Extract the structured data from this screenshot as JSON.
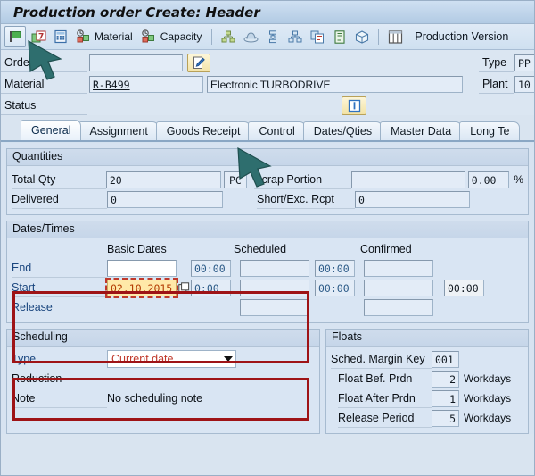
{
  "window": {
    "title": "Production order Create: Header"
  },
  "toolbar": {
    "icons": [
      {
        "name": "green-flag-icon",
        "glyph": "flag"
      },
      {
        "name": "order-info-icon",
        "glyph": "seven"
      },
      {
        "name": "calculator-icon",
        "glyph": "calc"
      }
    ],
    "material_label": "Material",
    "capacity_label": "Capacity",
    "production_version_label": "Production Version",
    "extra_icons": [
      {
        "name": "hierarchy-icon"
      },
      {
        "name": "hat-icon"
      },
      {
        "name": "operations-icon"
      },
      {
        "name": "network-icon"
      },
      {
        "name": "copy-document-icon"
      },
      {
        "name": "document-icon"
      },
      {
        "name": "box-icon"
      },
      {
        "name": "table-icon"
      }
    ]
  },
  "header": {
    "order_label": "Order",
    "order_value": "",
    "material_label": "Material",
    "material_value": "R-B499",
    "material_desc": "Electronic TURBODRIVE",
    "status_label": "Status",
    "status_value": "",
    "type_label": "Type",
    "type_value": "PP",
    "plant_label": "Plant",
    "plant_value": "10"
  },
  "tabs": [
    {
      "label": "General",
      "active": true
    },
    {
      "label": "Assignment",
      "active": false
    },
    {
      "label": "Goods Receipt",
      "active": false
    },
    {
      "label": "Control",
      "active": false
    },
    {
      "label": "Dates/Qties",
      "active": false
    },
    {
      "label": "Master Data",
      "active": false
    },
    {
      "label": "Long Te",
      "active": false
    }
  ],
  "quantities": {
    "title": "Quantities",
    "total_qty_label": "Total Qty",
    "total_qty_value": "20",
    "uom": "PC",
    "delivered_label": "Delivered",
    "delivered_value": "0",
    "scrap_label": "Scrap Portion",
    "scrap_value": "",
    "scrap_pct_value": "0.00",
    "pct_sign": "%",
    "short_exc_label": "Short/Exc. Rcpt",
    "short_exc_value": "0"
  },
  "dates": {
    "title": "Dates/Times",
    "col_basic": "Basic Dates",
    "col_scheduled": "Scheduled",
    "col_confirmed": "Confirmed",
    "rows": [
      {
        "label": "End",
        "basic_date": "",
        "basic_time": "00:00",
        "scheduled_date": "",
        "scheduled_time": "00:00",
        "confirmed_date": "",
        "confirmed_time": ""
      },
      {
        "label": "Start",
        "basic_date": "02.10.2015",
        "basic_time": "0:00",
        "scheduled_date": "",
        "scheduled_time": "00:00",
        "confirmed_date": "",
        "confirmed_time": "00:00"
      },
      {
        "label": "Release",
        "basic_date": "",
        "basic_time": "",
        "scheduled_date": "",
        "scheduled_time": "",
        "confirmed_date": "",
        "confirmed_time": ""
      }
    ]
  },
  "scheduling": {
    "title": "Scheduling",
    "type_label": "Type",
    "type_value": "Current date",
    "reduction_label": "Reduction",
    "reduction_value": "",
    "note_label": "Note",
    "note_value": "No scheduling note"
  },
  "floats": {
    "title": "Floats",
    "margin_key_label": "Sched. Margin Key",
    "margin_key_value": "001",
    "rows": [
      {
        "label": "Float Bef. Prdn",
        "value": "2",
        "unit": "Workdays"
      },
      {
        "label": "Float After Prdn",
        "value": "1",
        "unit": "Workdays"
      },
      {
        "label": "Release Period",
        "value": "5",
        "unit": "Workdays"
      }
    ]
  },
  "colors": {
    "background": "#d7e3f1",
    "annotation_red": "#9e1316",
    "focus_yellow": "#ffe9a8",
    "focus_text": "#b33a00",
    "cursor_teal": "#2e6e6e",
    "title_blue": "#bfd4ea"
  }
}
